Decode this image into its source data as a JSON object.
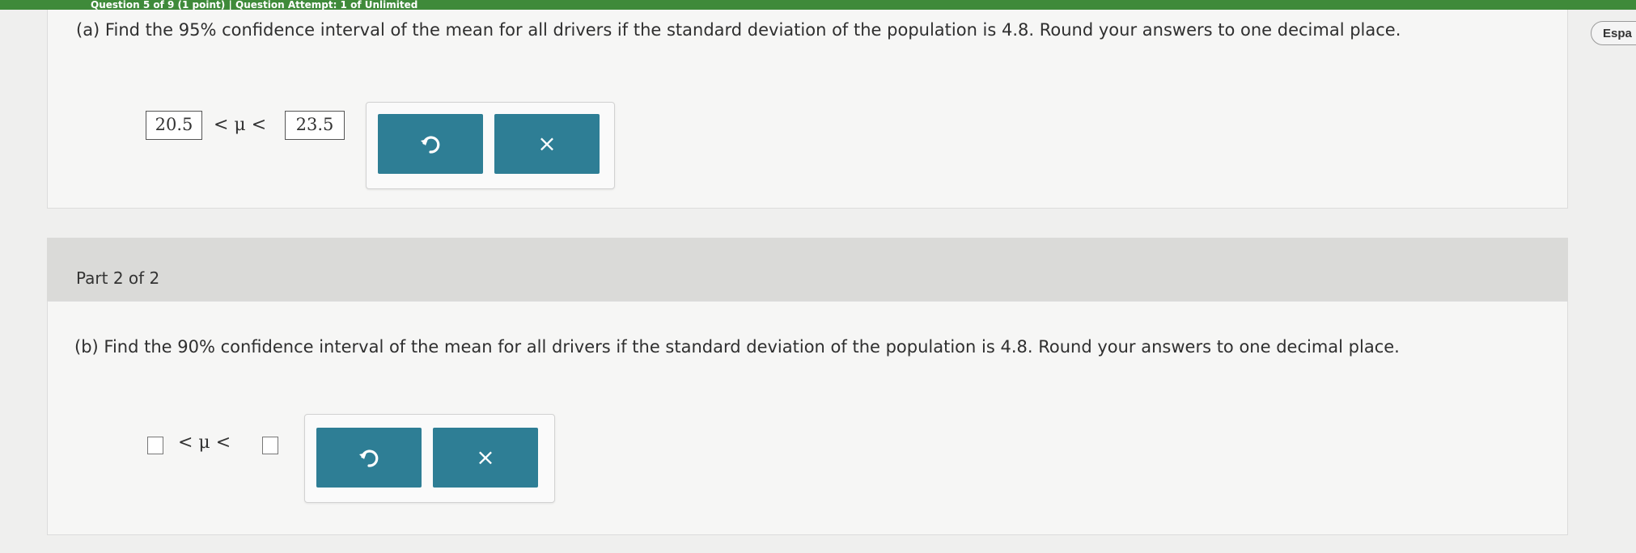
{
  "header": {
    "question_info": "Question 5 of 9 (1 point)  |  Question Attempt: 1 of Unlimited",
    "language_button": "Espa"
  },
  "part_a": {
    "question": "(a) Find the 95% confidence interval of the mean for all drivers if the standard deviation of the population is 4.8. Round your answers to one decimal place.",
    "lower_value": "20.5",
    "upper_value": "23.5",
    "inequality": "< μ <"
  },
  "part_header": {
    "label": "Part 2 of 2"
  },
  "part_b": {
    "question": "(b) Find the 90% confidence interval of the mean for all drivers if the standard deviation of the population is 4.8. Round your answers to one decimal place.",
    "lower_value": "",
    "upper_value": "",
    "inequality": "< μ <"
  },
  "buttons": {
    "undo_icon": "undo-icon",
    "clear_icon": "clear-x-icon",
    "clear_glyph": "×"
  },
  "colors": {
    "top_bar": "#3f8a3a",
    "button": "#2e7e95"
  }
}
